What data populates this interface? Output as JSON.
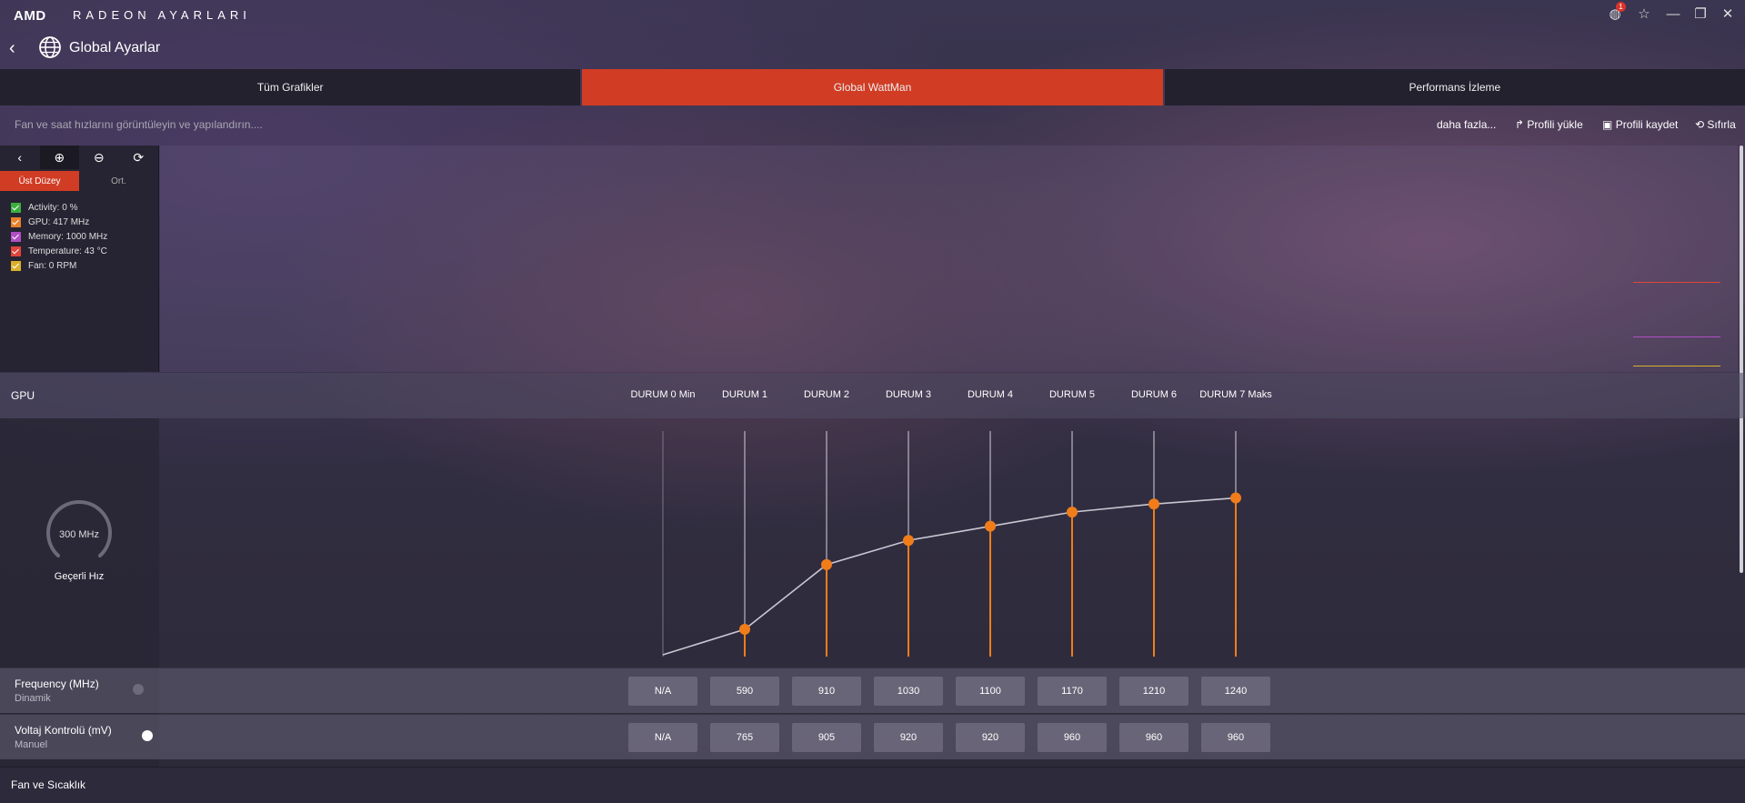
{
  "app": {
    "logo": "AMD",
    "name": "RADEON AYARLARI",
    "notification_count": "1"
  },
  "header": {
    "back_icon": "back-arrow-icon",
    "page_title": "Global Ayarlar"
  },
  "tabs": [
    {
      "label": "Tüm Grafikler",
      "active": false
    },
    {
      "label": "Global WattMan",
      "active": true
    },
    {
      "label": "Performans İzleme",
      "active": false
    }
  ],
  "subbar": {
    "description": "Fan ve saat hızlarını görüntüleyin ve yapılandırın....",
    "more": "daha fazla...",
    "load_profile": "Profili yükle",
    "save_profile": "Profili kaydet",
    "reset": "Sıfırla"
  },
  "monitor": {
    "modes": [
      "Üst Düzey",
      "Ort."
    ],
    "legend": [
      {
        "label": "Activity: 0 %",
        "color": "#3cae3f"
      },
      {
        "label": "GPU: 417 MHz",
        "color": "#e8802a"
      },
      {
        "label": "Memory: 1000 MHz",
        "color": "#b04fc4"
      },
      {
        "label": "Temperature: 43 °C",
        "color": "#e0443a"
      },
      {
        "label": "Fan: 0 RPM",
        "color": "#d9b02d"
      }
    ]
  },
  "gpu": {
    "label": "GPU",
    "states": [
      "DURUM 0 Min",
      "DURUM 1",
      "DURUM 2",
      "DURUM 3",
      "DURUM 4",
      "DURUM 5",
      "DURUM 6",
      "DURUM 7 Maks"
    ],
    "gauge_value": "300 MHz",
    "gauge_caption": "Geçerli Hız"
  },
  "frequency": {
    "title": "Frequency (MHz)",
    "mode": "Dinamik",
    "toggle_on": false,
    "values": [
      "N/A",
      "590",
      "910",
      "1030",
      "1100",
      "1170",
      "1210",
      "1240"
    ]
  },
  "voltage": {
    "title": "Voltaj Kontrolü (mV)",
    "mode": "Manuel",
    "toggle_on": true,
    "values": [
      "N/A",
      "765",
      "905",
      "920",
      "920",
      "960",
      "960",
      "960"
    ]
  },
  "fan": {
    "label": "Fan ve Sıcaklık"
  },
  "colors": {
    "accent": "#d03c24",
    "curve_point": "#f07d1a"
  }
}
